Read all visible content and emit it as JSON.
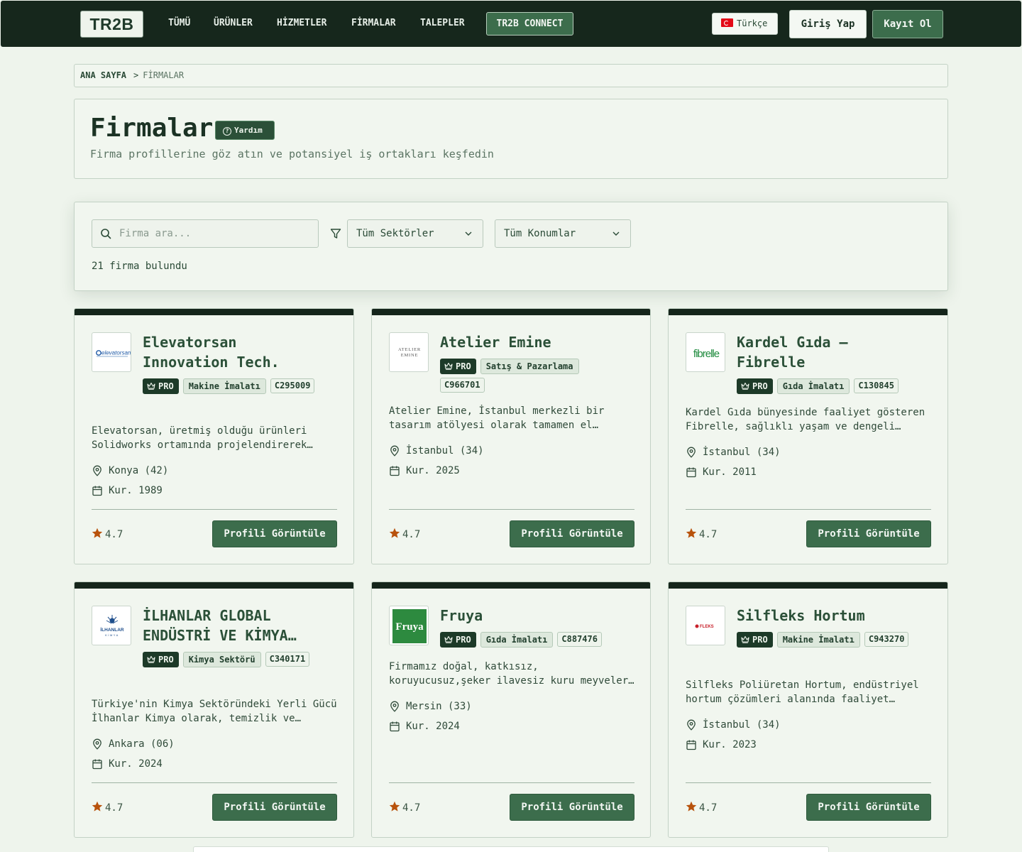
{
  "nav": {
    "logo": "TR2B",
    "links": [
      "TÜMÜ",
      "ÜRÜNLER",
      "HİZMETLER",
      "FİRMALAR",
      "TALEPLER"
    ],
    "connect": "TR2B CONNECT",
    "language": "Türkçe",
    "login": "Giriş Yap",
    "register": "Kayıt Ol"
  },
  "breadcrumb": {
    "home": "ANA SAYFA",
    "separator": ">",
    "current": "FİRMALAR"
  },
  "header": {
    "title": "Firmalar",
    "help": "Yardım",
    "subtitle": "Firma profillerine göz atın ve potansiyel iş ortakları keşfedin"
  },
  "filters": {
    "search_placeholder": "Firma ara...",
    "sector": "Tüm Sektörler",
    "location": "Tüm Konumlar",
    "result_count": "21 firma bulundu"
  },
  "cards": [
    {
      "logo_text": "elevatorsan",
      "name_line1": "Elevatorsan",
      "name_line2": "Innovation Tech.",
      "pro": "PRO",
      "sector": "Makine İmalatı",
      "code": "C295009",
      "desc_line1": "Elevatorsan, üretmiş olduğu ürünleri",
      "desc_line2": "Solidworks ortamında projelendirerek…",
      "location": "Konya (42)",
      "founded": "Kur. 1989",
      "rating": "4.7",
      "button": "Profili Görüntüle"
    },
    {
      "logo_text_1": "ATELIER",
      "logo_text_2": "EMINE",
      "name_line1": "Atelier Emine",
      "name_line2": "",
      "pro": "PRO",
      "sector": "Satış & Pazarlama",
      "code": "C966701",
      "desc_line1": "Atelier Emine, İstanbul merkezli bir",
      "desc_line2": "tasarım atölyesi olarak tamamen el…",
      "location": "İstanbul (34)",
      "founded": "Kur. 2025",
      "rating": "4.7",
      "button": "Profili Görüntüle"
    },
    {
      "logo_text": "fibrelle",
      "name_line1": "Kardel Gıda –",
      "name_line2": "Fibrelle",
      "pro": "PRO",
      "sector": "Gıda İmalatı",
      "code": "C130845",
      "desc_line1": "Kardel Gıda bünyesinde faaliyet gösteren",
      "desc_line2": "Fibrelle, sağlıklı yaşam ve dengeli…",
      "location": "İstanbul (34)",
      "founded": "Kur. 2011",
      "rating": "4.7",
      "button": "Profili Görüntüle"
    },
    {
      "logo_text": "İLHANLAR",
      "logo_sub": "KİMYA",
      "name_line1": "İLHANLAR GLOBAL",
      "name_line2": "ENDÜSTRİ VE KİMYA…",
      "pro": "PRO",
      "sector": "Kimya Sektörü",
      "code": "C340171",
      "desc_line1": "Türkiye'nin Kimya Sektöründeki Yerli Gücü",
      "desc_line2": "İlhanlar Kimya olarak, temizlik ve…",
      "location": "Ankara (06)",
      "founded": "Kur. 2024",
      "rating": "4.7",
      "button": "Profili Görüntüle"
    },
    {
      "logo_text": "Fruya",
      "name_line1": "Fruya",
      "name_line2": "",
      "pro": "PRO",
      "sector": "Gıda İmalatı",
      "code": "C887476",
      "desc_line1": "Firmamız doğal, katkısız,",
      "desc_line2": "koruyucusuz,şeker ilavesiz kuru meyveler…",
      "location": "Mersin (33)",
      "founded": "Kur. 2024",
      "rating": "4.7",
      "button": "Profili Görüntüle"
    },
    {
      "logo_text": "FLEKS",
      "name_line1": "Silfleks Hortum",
      "name_line2": "",
      "pro": "PRO",
      "sector": "Makine İmalatı",
      "code": "C943270",
      "desc_line1": "Silfleks Poliüretan Hortum, endüstriyel",
      "desc_line2": "hortum çözümleri alanında faaliyet…",
      "location": "İstanbul (34)",
      "founded": "Kur. 2023",
      "rating": "4.7",
      "button": "Profili Görüntüle"
    }
  ],
  "icons": {
    "star_color": "#b8520c",
    "accent": "#3c6d4c",
    "dark": "#16271c"
  }
}
